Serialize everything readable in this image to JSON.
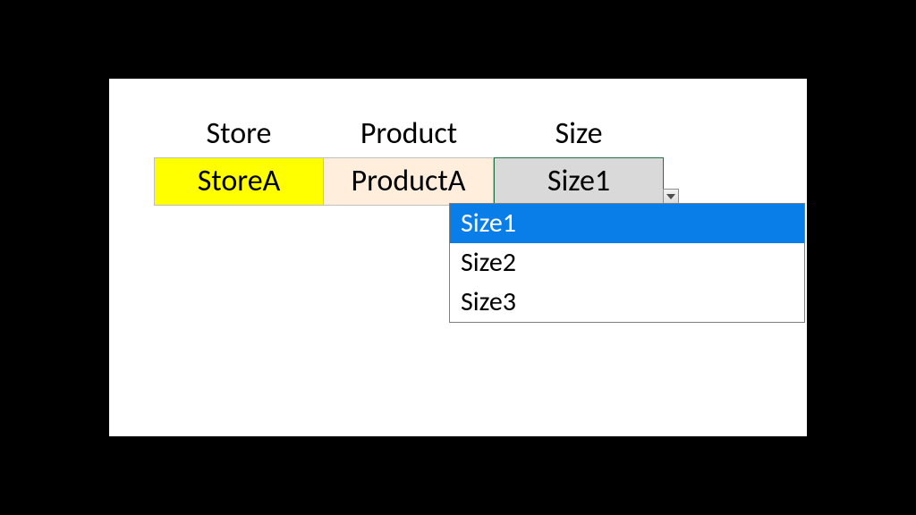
{
  "headers": {
    "store": "Store",
    "product": "Product",
    "size": "Size"
  },
  "cells": {
    "store": "StoreA",
    "product": "ProductA",
    "size": "Size1"
  },
  "dropdown": {
    "options": [
      "Size1",
      "Size2",
      "Size3"
    ],
    "selected_index": 0
  },
  "colors": {
    "store_bg": "#ffff00",
    "product_bg": "#ffeedb",
    "size_bg": "#d9d9d9",
    "selection": "#0a7ee8",
    "active_border": "#217346"
  }
}
